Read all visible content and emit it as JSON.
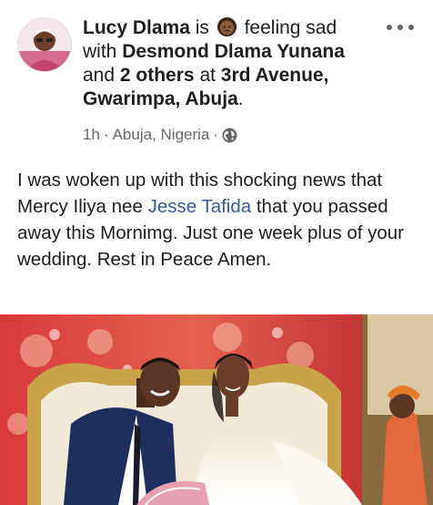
{
  "post": {
    "author": "Lucy Dlama",
    "is_word": "is",
    "feeling": "feeling sad",
    "with_word": "with",
    "tagged_person": "Desmond Dlama Yunana",
    "and_word": "and",
    "others": "2 others",
    "at_word": "at",
    "location": "3rd Avenue, Gwarimpa, Abuja",
    "period": ".",
    "time": "1h",
    "place": "Abuja, Nigeria",
    "separator": "·",
    "privacy_icon": "globe-icon",
    "more_icon": "more-options-icon",
    "feeling_icon": "sad-woman-emoji-icon",
    "body": {
      "part1": "I was woken up with this shocking  news that Mercy Iliya  nee ",
      "mention": "Jesse Tafida",
      "part2": " that you passed away this Mornimg. Just one week plus of your wedding. Rest in Peace Amen."
    },
    "photo_icon": "wedding-photo"
  },
  "colors": {
    "text": "#1c1e21",
    "secondary": "#65676b",
    "link": "#385898"
  }
}
